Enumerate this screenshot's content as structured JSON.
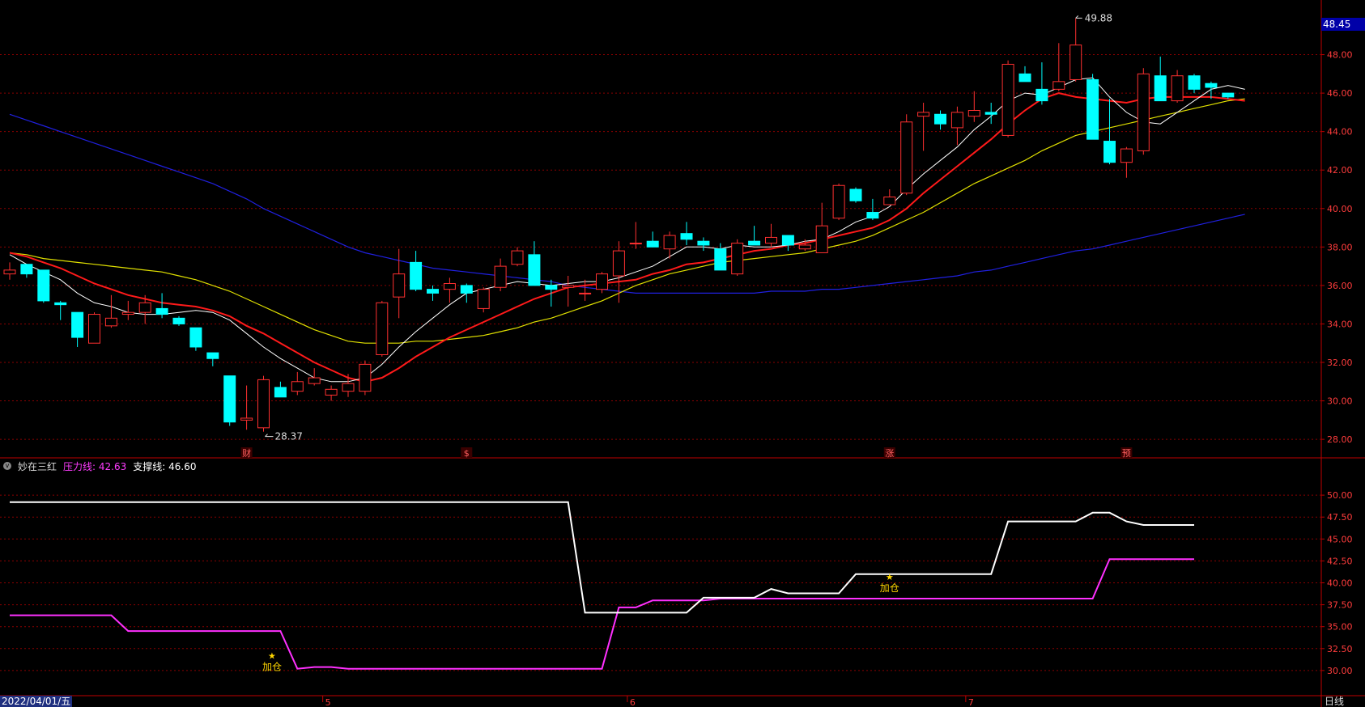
{
  "indicator": {
    "name": "妙在三红",
    "pressure_label": "压力线:",
    "pressure_value": "42.63",
    "support_label": "支撑线:",
    "support_value": "46.60"
  },
  "price_tag": "48.45",
  "date_tag": "2022/04/01/五",
  "period_label": "日线",
  "colors": {
    "up": "#ff3030",
    "down": "#00ffff",
    "ma5": "#ffffff",
    "ma10": "#ff1a1a",
    "ma20": "#e0e000",
    "ma60": "#2020e0",
    "pressure": "#ff30ff",
    "support": "#ffffff",
    "grid": "#8a0000",
    "axis": "#c00000",
    "tick": "#ff3c3c"
  },
  "chart_data": [
    {
      "type": "candlestick",
      "ylim": [
        27.5,
        50.0
      ],
      "y_ticks": [
        "28.00",
        "30.00",
        "32.00",
        "34.00",
        "36.00",
        "38.00",
        "40.00",
        "42.00",
        "44.00",
        "46.00",
        "48.00"
      ],
      "candles": [
        [
          36.6,
          37.2,
          36.3,
          36.8
        ],
        [
          37.1,
          37.1,
          36.4,
          36.6
        ],
        [
          36.8,
          36.8,
          35.1,
          35.2
        ],
        [
          35.1,
          35.2,
          34.2,
          35.0
        ],
        [
          34.6,
          34.6,
          32.8,
          33.3
        ],
        [
          33.0,
          34.6,
          33.0,
          34.5
        ],
        [
          33.9,
          35.5,
          33.8,
          34.3
        ],
        [
          34.5,
          35.2,
          34.2,
          34.6
        ],
        [
          34.6,
          35.5,
          34.0,
          35.1
        ],
        [
          34.8,
          35.6,
          34.3,
          34.5
        ],
        [
          34.3,
          34.4,
          33.9,
          34.0
        ],
        [
          33.8,
          33.8,
          32.6,
          32.8
        ],
        [
          32.5,
          32.5,
          31.8,
          32.2
        ],
        [
          31.3,
          31.3,
          28.7,
          28.9
        ],
        [
          29.0,
          30.8,
          28.5,
          29.1
        ],
        [
          28.6,
          31.3,
          28.4,
          31.1
        ],
        [
          30.7,
          31.0,
          30.2,
          30.2
        ],
        [
          30.5,
          31.5,
          30.3,
          31.0
        ],
        [
          30.9,
          31.7,
          30.8,
          31.2
        ],
        [
          30.3,
          30.8,
          30.0,
          30.6
        ],
        [
          30.5,
          31.4,
          30.2,
          30.9
        ],
        [
          30.5,
          32.1,
          30.3,
          31.9
        ],
        [
          32.4,
          35.2,
          32.3,
          35.1
        ],
        [
          35.4,
          37.9,
          34.3,
          36.6
        ],
        [
          37.2,
          37.8,
          35.7,
          35.8
        ],
        [
          35.8,
          36.0,
          35.2,
          35.6
        ],
        [
          35.8,
          36.4,
          35.1,
          36.1
        ],
        [
          36.0,
          36.1,
          35.1,
          35.6
        ],
        [
          34.8,
          35.9,
          34.6,
          35.8
        ],
        [
          35.9,
          37.4,
          35.7,
          37.0
        ],
        [
          37.1,
          38.0,
          37.0,
          37.8
        ],
        [
          37.6,
          38.3,
          36.0,
          36.0
        ],
        [
          36.0,
          36.3,
          34.9,
          35.8
        ],
        [
          35.9,
          36.5,
          34.9,
          36.0
        ],
        [
          35.6,
          36.3,
          35.2,
          35.6
        ],
        [
          35.8,
          36.7,
          35.6,
          36.6
        ],
        [
          36.5,
          38.3,
          35.1,
          37.8
        ],
        [
          38.2,
          39.3,
          37.9,
          38.2
        ],
        [
          38.3,
          38.8,
          38.0,
          38.0
        ],
        [
          37.9,
          38.8,
          37.4,
          38.6
        ],
        [
          38.7,
          39.3,
          38.1,
          38.4
        ],
        [
          38.3,
          38.5,
          37.8,
          38.1
        ],
        [
          37.9,
          38.2,
          36.8,
          36.8
        ],
        [
          36.6,
          38.4,
          36.5,
          38.2
        ],
        [
          38.3,
          39.1,
          38.1,
          38.1
        ],
        [
          38.2,
          39.2,
          38.0,
          38.5
        ],
        [
          38.6,
          38.6,
          37.8,
          38.1
        ],
        [
          37.9,
          38.4,
          37.8,
          38.1
        ],
        [
          37.7,
          40.3,
          37.7,
          39.1
        ],
        [
          39.5,
          41.3,
          39.4,
          41.2
        ],
        [
          41.0,
          41.1,
          40.3,
          40.4
        ],
        [
          39.8,
          40.5,
          39.4,
          39.5
        ],
        [
          40.2,
          41.0,
          40.2,
          40.6
        ],
        [
          40.8,
          44.9,
          40.7,
          44.5
        ],
        [
          44.8,
          45.5,
          43.0,
          45.0
        ],
        [
          44.9,
          45.1,
          44.1,
          44.4
        ],
        [
          44.2,
          45.3,
          43.3,
          45.0
        ],
        [
          44.8,
          46.1,
          44.5,
          45.1
        ],
        [
          45.0,
          45.5,
          44.4,
          44.9
        ],
        [
          43.8,
          47.7,
          43.7,
          47.5
        ],
        [
          47.0,
          47.4,
          46.6,
          46.6
        ],
        [
          46.2,
          47.6,
          45.4,
          45.6
        ],
        [
          46.2,
          48.6,
          46.1,
          46.6
        ],
        [
          46.7,
          49.9,
          46.6,
          48.5
        ],
        [
          46.7,
          47.0,
          43.6,
          43.6
        ],
        [
          43.5,
          45.7,
          42.3,
          42.4
        ],
        [
          42.4,
          43.2,
          41.6,
          43.1
        ],
        [
          43.0,
          47.3,
          42.8,
          47.0
        ],
        [
          46.9,
          47.9,
          45.6,
          45.6
        ],
        [
          45.6,
          47.2,
          45.5,
          46.9
        ],
        [
          46.9,
          47.0,
          46.0,
          46.2
        ],
        [
          46.5,
          46.6,
          45.7,
          46.3
        ],
        [
          46.0,
          46.0,
          45.7,
          45.8
        ]
      ],
      "ma5": [
        37.6,
        37.1,
        36.7,
        36.3,
        35.6,
        35.1,
        34.9,
        34.6,
        34.5,
        34.5,
        34.6,
        34.7,
        34.6,
        34.2,
        33.5,
        32.8,
        32.2,
        31.7,
        31.2,
        31.0,
        31.0,
        31.2,
        31.9,
        32.8,
        33.6,
        34.3,
        35.0,
        35.6,
        35.8,
        36.0,
        36.2,
        36.1,
        36.0,
        36.1,
        36.2,
        36.2,
        36.4,
        36.7,
        37.0,
        37.5,
        38.0,
        38.0,
        37.9,
        38.1,
        38.0,
        38.0,
        38.1,
        38.3,
        38.4,
        38.8,
        39.3,
        39.6,
        40.1,
        41.0,
        41.8,
        42.5,
        43.2,
        44.1,
        44.8,
        45.6,
        46.0,
        45.9,
        46.3,
        46.7,
        46.8,
        45.8,
        45.0,
        44.5,
        44.4,
        45.0,
        45.6,
        46.2,
        46.4,
        46.2
      ],
      "ma10": [
        37.7,
        37.5,
        37.2,
        36.9,
        36.5,
        36.1,
        35.8,
        35.5,
        35.3,
        35.1,
        35.0,
        34.9,
        34.7,
        34.4,
        33.9,
        33.5,
        33.0,
        32.5,
        32.0,
        31.6,
        31.2,
        31.0,
        31.2,
        31.7,
        32.3,
        32.8,
        33.3,
        33.7,
        34.1,
        34.5,
        34.9,
        35.3,
        35.6,
        35.9,
        36.0,
        36.1,
        36.2,
        36.3,
        36.6,
        36.8,
        37.1,
        37.2,
        37.4,
        37.6,
        37.8,
        37.9,
        38.1,
        38.2,
        38.4,
        38.6,
        38.8,
        39.0,
        39.4,
        40.0,
        40.8,
        41.5,
        42.2,
        42.9,
        43.6,
        44.4,
        45.1,
        45.7,
        46.0,
        45.8,
        45.7,
        45.6,
        45.5,
        45.7,
        45.8,
        45.8,
        45.8,
        45.8,
        45.7,
        45.6
      ],
      "ma20": [
        37.7,
        37.6,
        37.4,
        37.3,
        37.2,
        37.1,
        37.0,
        36.9,
        36.8,
        36.7,
        36.5,
        36.3,
        36.0,
        35.7,
        35.3,
        34.9,
        34.5,
        34.1,
        33.7,
        33.4,
        33.1,
        33.0,
        33.0,
        33.0,
        33.1,
        33.1,
        33.2,
        33.3,
        33.4,
        33.6,
        33.8,
        34.1,
        34.3,
        34.6,
        34.9,
        35.2,
        35.6,
        36.0,
        36.3,
        36.6,
        36.8,
        37.0,
        37.2,
        37.3,
        37.4,
        37.5,
        37.6,
        37.7,
        37.9,
        38.1,
        38.3,
        38.6,
        39.0,
        39.4,
        39.8,
        40.3,
        40.8,
        41.3,
        41.7,
        42.1,
        42.5,
        43.0,
        43.4,
        43.8,
        44.0,
        44.2,
        44.4,
        44.6,
        44.8,
        45.0,
        45.2,
        45.4,
        45.6,
        45.7
      ],
      "ma60": [
        44.9,
        44.6,
        44.3,
        44.0,
        43.7,
        43.4,
        43.1,
        42.8,
        42.5,
        42.2,
        41.9,
        41.6,
        41.3,
        40.9,
        40.5,
        40.0,
        39.6,
        39.2,
        38.8,
        38.4,
        38.0,
        37.7,
        37.5,
        37.3,
        37.1,
        36.9,
        36.8,
        36.7,
        36.6,
        36.5,
        36.4,
        36.3,
        36.2,
        36.0,
        35.9,
        35.8,
        35.7,
        35.6,
        35.6,
        35.6,
        35.6,
        35.6,
        35.6,
        35.6,
        35.6,
        35.7,
        35.7,
        35.7,
        35.8,
        35.8,
        35.9,
        36.0,
        36.1,
        36.2,
        36.3,
        36.4,
        36.5,
        36.7,
        36.8,
        37.0,
        37.2,
        37.4,
        37.6,
        37.8,
        37.9,
        38.1,
        38.3,
        38.5,
        38.7,
        38.9,
        39.1,
        39.3,
        39.5,
        39.7
      ],
      "annotations": {
        "high_label": "49.88",
        "low_label": "28.37",
        "markers": [
          {
            "index": 14,
            "text": "财"
          },
          {
            "index": 27,
            "text": "$"
          },
          {
            "index": 52,
            "text": "涨"
          },
          {
            "index": 66,
            "text": "预"
          }
        ]
      }
    },
    {
      "type": "line",
      "ylim": [
        27.5,
        52.5
      ],
      "y_ticks": [
        "30.00",
        "32.50",
        "35.00",
        "37.50",
        "40.00",
        "42.50",
        "45.00",
        "47.50",
        "50.00"
      ],
      "series": [
        {
          "name": "压力线",
          "points": [
            [
              0,
              36.3
            ],
            [
              6,
              36.3
            ],
            [
              7,
              34.5
            ],
            [
              8,
              34.5
            ],
            [
              16,
              34.5
            ],
            [
              17,
              30.2
            ],
            [
              18,
              30.4
            ],
            [
              19,
              30.4
            ],
            [
              20,
              30.2
            ],
            [
              35,
              30.2
            ],
            [
              36,
              37.2
            ],
            [
              37,
              37.2
            ],
            [
              38,
              38.0
            ],
            [
              41,
              38.0
            ],
            [
              42,
              38.2
            ],
            [
              63,
              38.2
            ],
            [
              64,
              38.2
            ],
            [
              65,
              42.7
            ],
            [
              66,
              42.7
            ],
            [
              70,
              42.7
            ]
          ]
        },
        {
          "name": "支撑线",
          "points": [
            [
              0,
              49.2
            ],
            [
              33,
              49.2
            ],
            [
              34,
              36.6
            ],
            [
              40,
              36.6
            ],
            [
              41,
              38.3
            ],
            [
              44,
              38.3
            ],
            [
              45,
              39.3
            ],
            [
              46,
              38.8
            ],
            [
              49,
              38.8
            ],
            [
              50,
              41.0
            ],
            [
              58,
              41.0
            ],
            [
              59,
              47.0
            ],
            [
              60,
              47.0
            ],
            [
              63,
              47.0
            ],
            [
              64,
              48.0
            ],
            [
              65,
              48.0
            ],
            [
              66,
              47.0
            ],
            [
              67,
              46.6
            ],
            [
              70,
              46.6
            ]
          ]
        }
      ],
      "signals": [
        {
          "index": 15.5,
          "text": "加仓",
          "value": 30.6
        },
        {
          "index": 52,
          "text": "加仓",
          "value": 39.6
        }
      ],
      "x_ticks": [
        {
          "index": 18.5,
          "text": "5"
        },
        {
          "index": 36.5,
          "text": "6"
        },
        {
          "index": 56.5,
          "text": "7"
        }
      ]
    }
  ]
}
